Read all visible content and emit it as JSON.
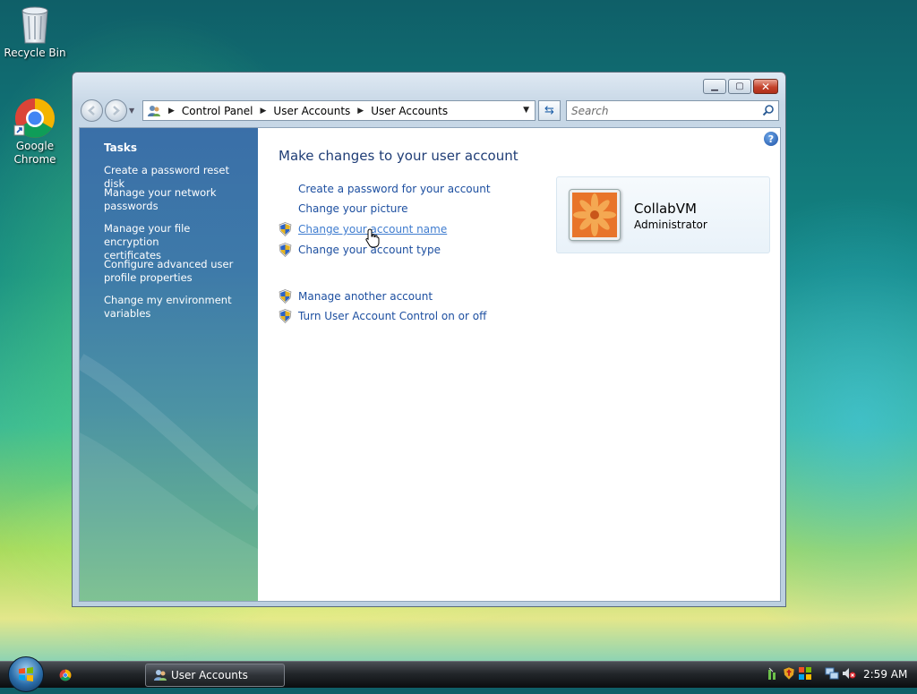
{
  "desktop": {
    "icons": [
      {
        "label": "Recycle Bin",
        "icon": "recycle-bin-icon"
      },
      {
        "label": "Google Chrome",
        "label_line1": "Google",
        "label_line2": "Chrome",
        "icon": "chrome-icon"
      }
    ]
  },
  "window": {
    "title": "User Accounts",
    "address": {
      "breadcrumbs": [
        "Control Panel",
        "User Accounts",
        "User Accounts"
      ]
    },
    "search": {
      "placeholder": "Search"
    },
    "tasks": {
      "title": "Tasks",
      "items": [
        {
          "label": "Create a password reset disk",
          "lines": [
            "Create a password reset disk"
          ]
        },
        {
          "label": "Manage your network passwords",
          "lines": [
            "Manage your network",
            "passwords"
          ]
        },
        {
          "label": "Manage your file encryption certificates",
          "lines": [
            "Manage your file encryption",
            "certificates"
          ]
        },
        {
          "label": "Configure advanced user profile properties",
          "lines": [
            "Configure advanced user",
            "profile properties"
          ]
        },
        {
          "label": "Change my environment variables",
          "lines": [
            "Change my environment",
            "variables"
          ]
        }
      ]
    },
    "main": {
      "heading": "Make changes to your user account",
      "links": [
        {
          "label": "Create a password for your account",
          "shield": false
        },
        {
          "label": "Change your picture",
          "shield": false
        },
        {
          "label": "Change your account name",
          "shield": true,
          "hover": true
        },
        {
          "label": "Change your account type",
          "shield": true
        }
      ],
      "other_links": [
        {
          "label": "Manage another account",
          "shield": true
        },
        {
          "label": "Turn User Account Control on or off",
          "shield": true
        }
      ],
      "account": {
        "name": "CollabVM",
        "role": "Administrator"
      }
    }
  },
  "taskbar": {
    "task_label": "User Accounts",
    "clock": "2:59 AM"
  },
  "colors": {
    "link": "#1d4fa0",
    "heading": "#1f3d76",
    "taskpane_top": "#3a6fa8",
    "taskpane_bottom": "#75bd8a"
  }
}
